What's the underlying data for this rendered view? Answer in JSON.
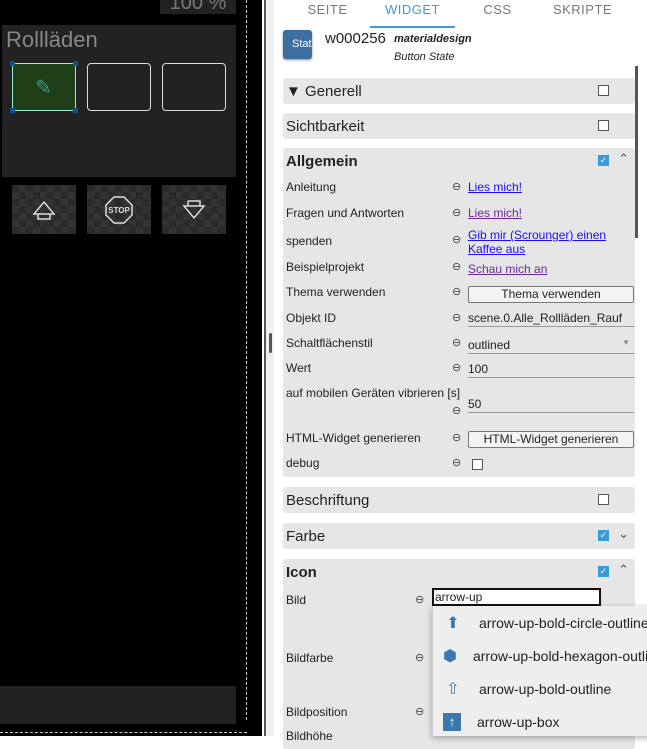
{
  "canvas": {
    "zoom_label": "100 %",
    "group_title": "Rollläden"
  },
  "tabs": [
    {
      "label": "SEITE"
    },
    {
      "label": "WIDGET"
    },
    {
      "label": "CSS"
    },
    {
      "label": "SKRIPTE"
    }
  ],
  "widget": {
    "icon_label": "Stat",
    "id": "w000256",
    "set": "materialdesign",
    "name": "Button State"
  },
  "sections": {
    "generell": "Generell",
    "sichtbarkeit": "Sichtbarkeit",
    "allgemein": "Allgemein",
    "beschriftung": "Beschriftung",
    "farbe": "Farbe",
    "icon": "Icon"
  },
  "allgemein": {
    "anleitung": {
      "label": "Anleitung",
      "link": "Lies mich!"
    },
    "faq": {
      "label": "Fragen und Antworten",
      "link": "Lies mich!"
    },
    "spenden": {
      "label": "spenden",
      "link": "Gib mir (Scrounger) einen Kaffee aus"
    },
    "beispiel": {
      "label": "Beispielprojekt",
      "link": "Schau mich an"
    },
    "thema": {
      "label": "Thema verwenden",
      "button": "Thema verwenden"
    },
    "oid": {
      "label": "Objekt ID",
      "value": "scene.0.Alle_Rollläden_Rauf"
    },
    "stil": {
      "label": "Schaltflächenstil",
      "value": "outlined"
    },
    "wert": {
      "label": "Wert",
      "value": "100"
    },
    "vibrieren": {
      "label": "auf mobilen Geräten vibrieren [s]",
      "value": "50"
    },
    "html": {
      "label": "HTML-Widget generieren",
      "button": "HTML-Widget generieren"
    },
    "debug": {
      "label": "debug"
    }
  },
  "icon": {
    "bild": "Bild",
    "bild_value": "arrow-up",
    "bildfarbe": "Bildfarbe",
    "bildposition": "Bildposition",
    "bildhoehe": "Bildhöhe"
  },
  "suggestions": [
    {
      "label": "arrow-up-bold-circle-outline",
      "icon": "arrow-circle-icon"
    },
    {
      "label": "arrow-up-bold-hexagon-outline",
      "icon": "arrow-hexagon-icon"
    },
    {
      "label": "arrow-up-bold-outline",
      "icon": "arrow-outline-icon"
    },
    {
      "label": "arrow-up-box",
      "icon": "arrow-box-icon"
    }
  ],
  "colors": {
    "accent": "#3a9ad9",
    "link": "#1a0dff"
  }
}
